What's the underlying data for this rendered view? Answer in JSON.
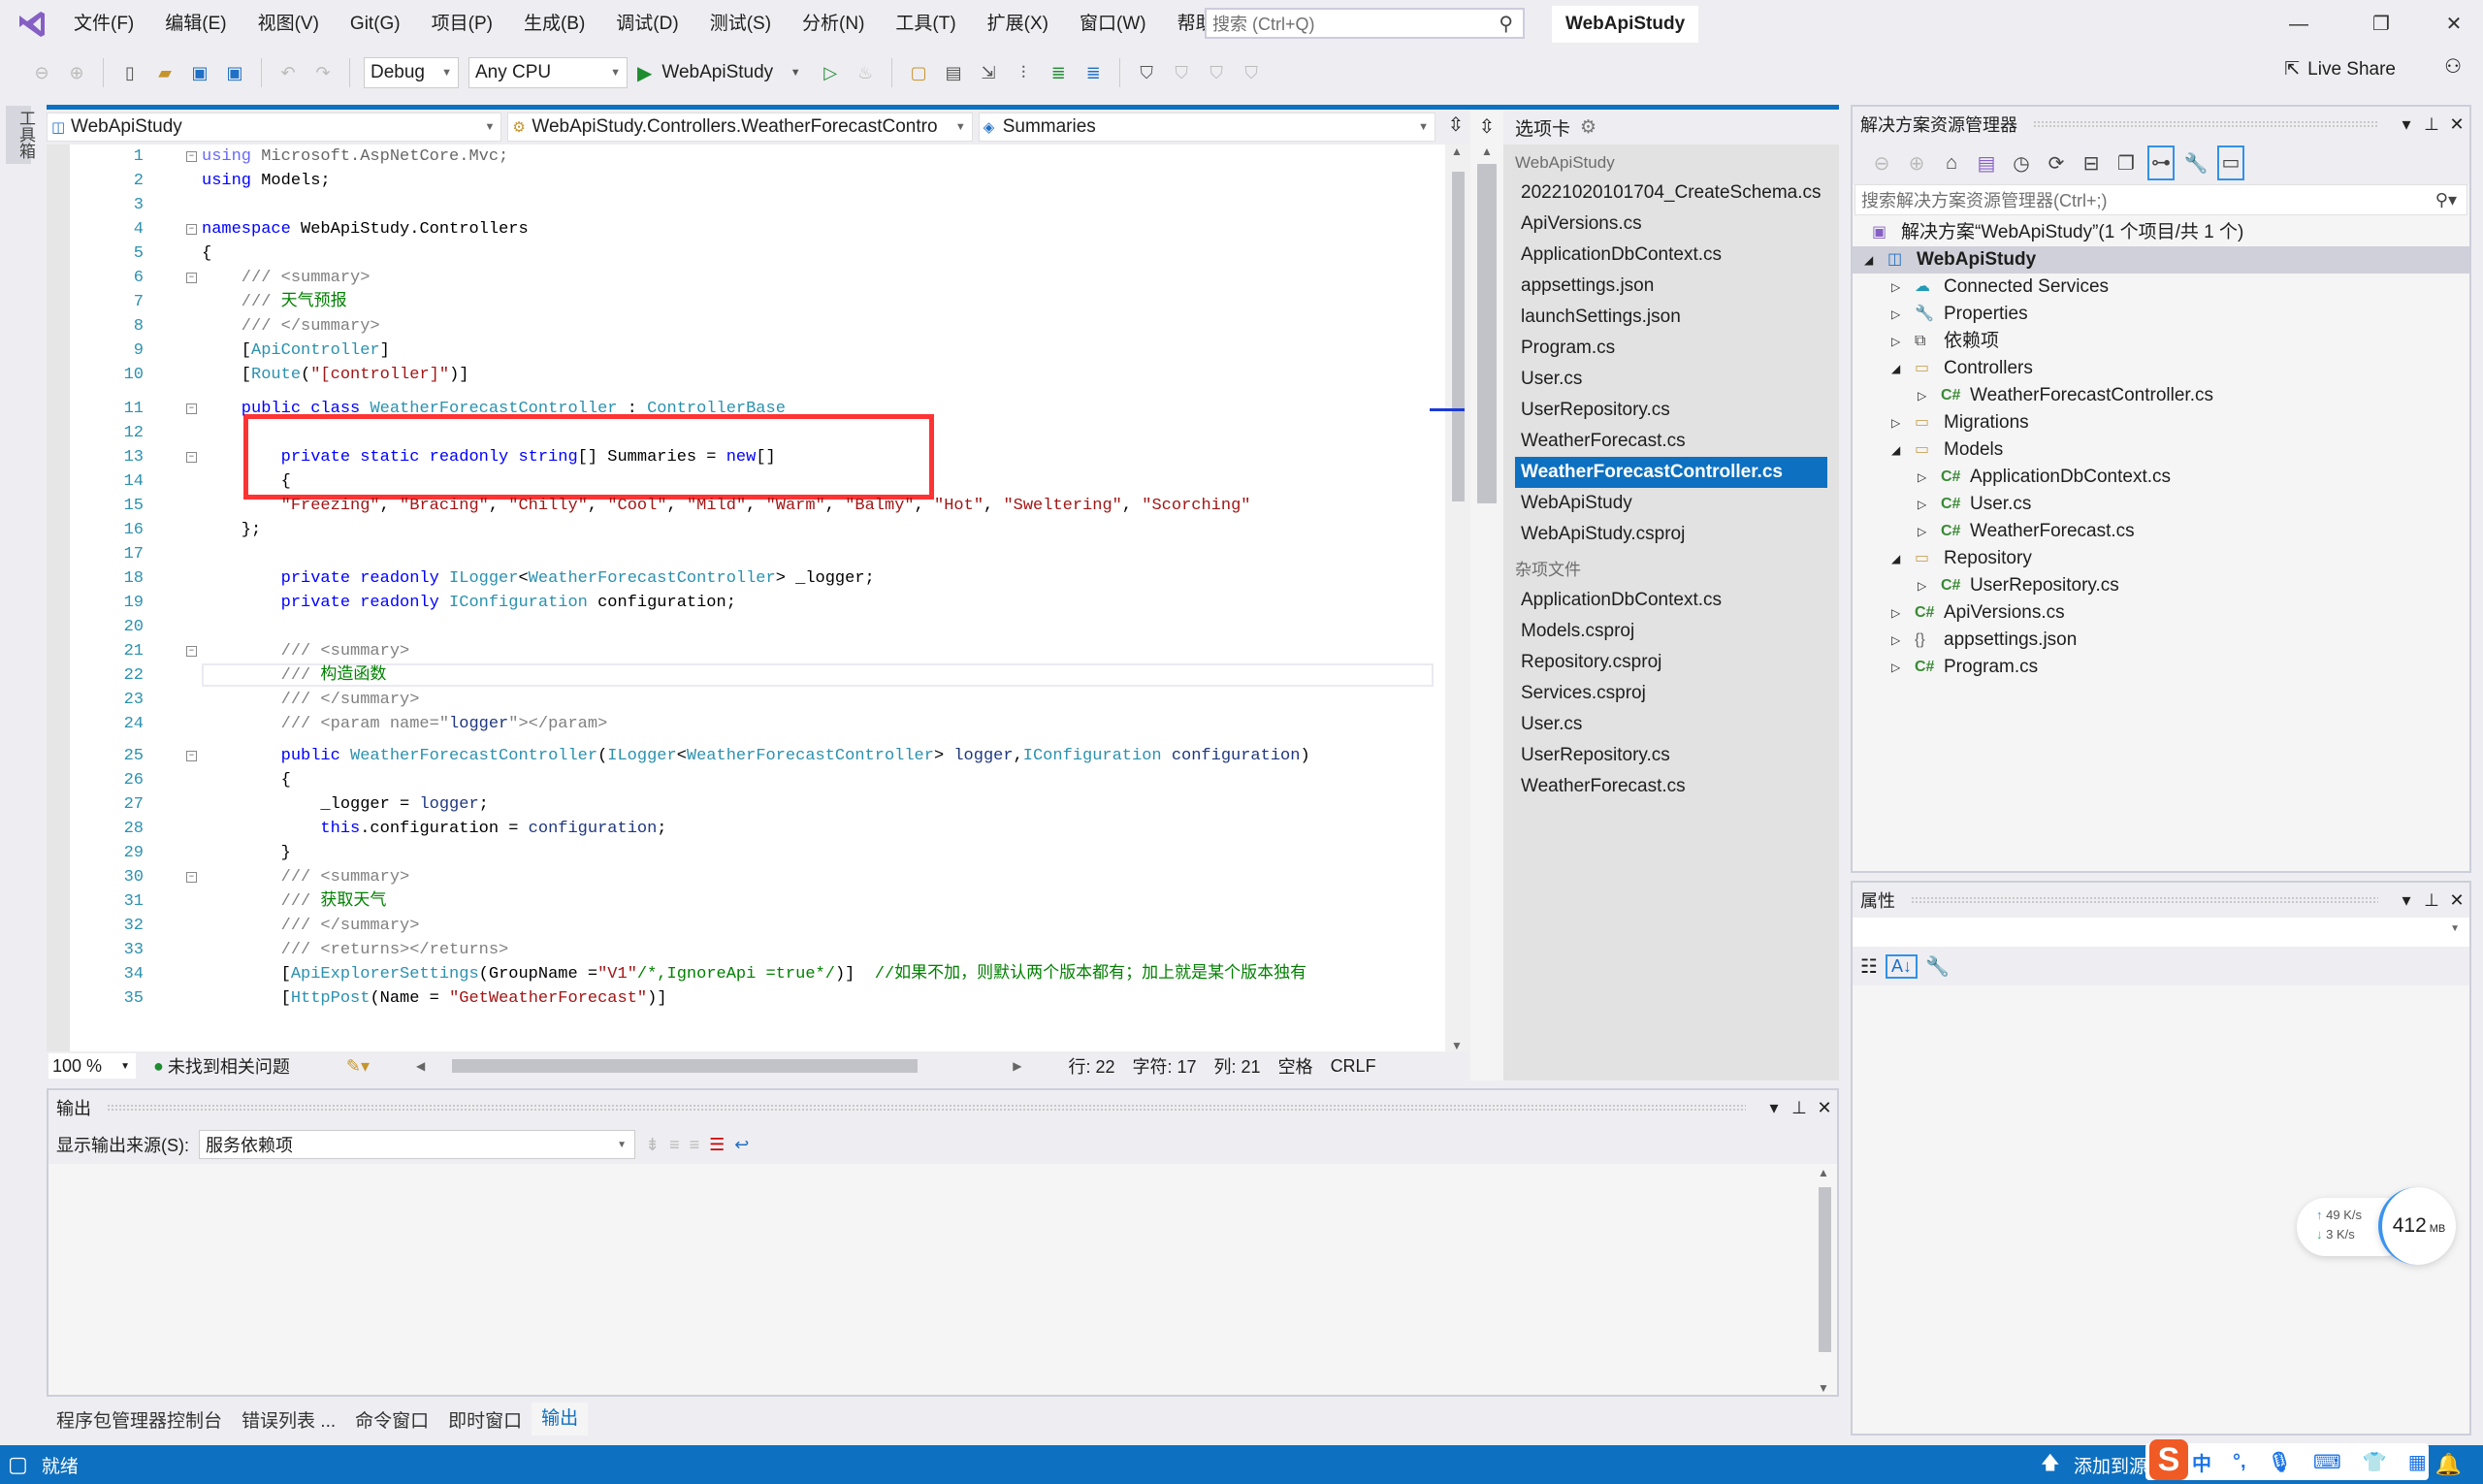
{
  "app": {
    "title": "WebApiStudy",
    "menu": [
      "文件(F)",
      "编辑(E)",
      "视图(V)",
      "Git(G)",
      "项目(P)",
      "生成(B)",
      "调试(D)",
      "测试(S)",
      "分析(N)",
      "工具(T)",
      "扩展(X)",
      "窗口(W)",
      "帮助(H)"
    ],
    "search_placeholder": "搜索 (Ctrl+Q)",
    "accent": "#0e70c0"
  },
  "toolbar": {
    "config": "Debug",
    "platform": "Any CPU",
    "run_target": "WebApiStudy",
    "live_share": "Live Share"
  },
  "left_strip": {
    "toolbox_label": "工具箱"
  },
  "editor": {
    "nav_project": "WebApiStudy",
    "nav_class": "WebApiStudy.Controllers.WeatherForecastContro",
    "nav_member": "Summaries",
    "lines": [
      {
        "n": "1",
        "seg": [
          [
            "kw",
            "using"
          ],
          [
            "pl",
            " Microsoft.AspNetCore.Mvc;"
          ]
        ],
        "dimmed": true,
        "fold": true
      },
      {
        "n": "2",
        "seg": [
          [
            "kw",
            "using"
          ],
          [
            "pl",
            " Models;"
          ]
        ]
      },
      {
        "n": "3",
        "seg": []
      },
      {
        "n": "4",
        "seg": [
          [
            "kw",
            "namespace"
          ],
          [
            "pl",
            " WebApiStudy.Controllers"
          ]
        ],
        "fold": true
      },
      {
        "n": "5",
        "seg": [
          [
            "pl",
            "{"
          ]
        ]
      },
      {
        "n": "6",
        "seg": [
          [
            "dc",
            "    /// <summary>"
          ]
        ],
        "fold": true
      },
      {
        "n": "7",
        "seg": [
          [
            "dc",
            "    /// "
          ],
          [
            "cm",
            "天气预报"
          ]
        ]
      },
      {
        "n": "8",
        "seg": [
          [
            "dc",
            "    /// </summary>"
          ]
        ]
      },
      {
        "n": "9",
        "seg": [
          [
            "pl",
            "    ["
          ],
          [
            "ty",
            "ApiController"
          ],
          [
            "pl",
            "]"
          ]
        ]
      },
      {
        "n": "10",
        "seg": [
          [
            "pl",
            "    ["
          ],
          [
            "ty",
            "Route"
          ],
          [
            "pl",
            "("
          ],
          [
            "st",
            "\"[controller]\""
          ],
          [
            "pl",
            ")]"
          ]
        ]
      },
      {
        "n": "11",
        "seg": [
          [
            "kw",
            "    public class "
          ],
          [
            "ty",
            "WeatherForecastController"
          ],
          [
            "pl",
            " : "
          ],
          [
            "ty",
            "ControllerBase"
          ]
        ],
        "fold": true
      },
      {
        "n": "12",
        "seg": []
      },
      {
        "n": "13",
        "seg": [
          [
            "kw",
            "        private static readonly string"
          ],
          [
            "pl",
            "[] Summaries = "
          ],
          [
            "kw",
            "new"
          ],
          [
            "pl",
            "[]"
          ]
        ],
        "fold": true
      },
      {
        "n": "14",
        "seg": [
          [
            "pl",
            "        {"
          ]
        ]
      },
      {
        "n": "15",
        "seg": [
          [
            "st",
            "        \"Freezing\""
          ],
          [
            "pl",
            ", "
          ],
          [
            "st",
            "\"Bracing\""
          ],
          [
            "pl",
            ", "
          ],
          [
            "st",
            "\"Chilly\""
          ],
          [
            "pl",
            ", "
          ],
          [
            "st",
            "\"Cool\""
          ],
          [
            "pl",
            ", "
          ],
          [
            "st",
            "\"Mild\""
          ],
          [
            "pl",
            ", "
          ],
          [
            "st",
            "\"Warm\""
          ],
          [
            "pl",
            ", "
          ],
          [
            "st",
            "\"Balmy\""
          ],
          [
            "pl",
            ", "
          ],
          [
            "st",
            "\"Hot\""
          ],
          [
            "pl",
            ", "
          ],
          [
            "st",
            "\"Sweltering\""
          ],
          [
            "pl",
            ", "
          ],
          [
            "st",
            "\"Scorching\""
          ]
        ]
      },
      {
        "n": "16",
        "seg": [
          [
            "pl",
            "    };"
          ]
        ]
      },
      {
        "n": "17",
        "seg": []
      },
      {
        "n": "18",
        "seg": [
          [
            "kw",
            "        private readonly "
          ],
          [
            "ty",
            "ILogger"
          ],
          [
            "pl",
            "<"
          ],
          [
            "ty",
            "WeatherForecastController"
          ],
          [
            "pl",
            "> _logger;"
          ]
        ]
      },
      {
        "n": "19",
        "seg": [
          [
            "kw",
            "        private readonly "
          ],
          [
            "ty",
            "IConfiguration"
          ],
          [
            "pl",
            " configuration;"
          ]
        ]
      },
      {
        "n": "20",
        "seg": []
      },
      {
        "n": "21",
        "seg": [
          [
            "dc",
            "        /// <summary>"
          ]
        ],
        "fold": true
      },
      {
        "n": "22",
        "seg": [
          [
            "dc",
            "        /// "
          ],
          [
            "cm",
            "构造函数"
          ]
        ],
        "current": true
      },
      {
        "n": "23",
        "seg": [
          [
            "dc",
            "        /// </summary>"
          ]
        ]
      },
      {
        "n": "24",
        "seg": [
          [
            "dc",
            "        /// <param name=\""
          ],
          [
            "id",
            "logger"
          ],
          [
            "dc",
            "\"></param>"
          ]
        ]
      },
      {
        "n": "25",
        "seg": [
          [
            "kw",
            "        public "
          ],
          [
            "ty",
            "WeatherForecastController"
          ],
          [
            "pl",
            "("
          ],
          [
            "ty",
            "ILogger"
          ],
          [
            "pl",
            "<"
          ],
          [
            "ty",
            "WeatherForecastController"
          ],
          [
            "pl",
            "> "
          ],
          [
            "id",
            "logger"
          ],
          [
            "pl",
            ","
          ],
          [
            "ty",
            "IConfiguration"
          ],
          [
            "pl",
            " "
          ],
          [
            "id",
            "configuration"
          ],
          [
            "pl",
            ")"
          ]
        ],
        "fold": true
      },
      {
        "n": "26",
        "seg": [
          [
            "pl",
            "        {"
          ]
        ]
      },
      {
        "n": "27",
        "seg": [
          [
            "pl",
            "            _logger = "
          ],
          [
            "id",
            "logger"
          ],
          [
            "pl",
            ";"
          ]
        ]
      },
      {
        "n": "28",
        "seg": [
          [
            "kw",
            "            this"
          ],
          [
            "pl",
            ".configuration = "
          ],
          [
            "id",
            "configuration"
          ],
          [
            "pl",
            ";"
          ]
        ]
      },
      {
        "n": "29",
        "seg": [
          [
            "pl",
            "        }"
          ]
        ]
      },
      {
        "n": "30",
        "seg": [
          [
            "dc",
            "        /// <summary>"
          ]
        ],
        "fold": true
      },
      {
        "n": "31",
        "seg": [
          [
            "dc",
            "        /// "
          ],
          [
            "cm",
            "获取天气"
          ]
        ]
      },
      {
        "n": "32",
        "seg": [
          [
            "dc",
            "        /// </summary>"
          ]
        ]
      },
      {
        "n": "33",
        "seg": [
          [
            "dc",
            "        /// <returns></returns>"
          ]
        ]
      },
      {
        "n": "34",
        "seg": [
          [
            "pl",
            "        ["
          ],
          [
            "ty",
            "ApiExplorerSettings"
          ],
          [
            "pl",
            "(GroupName ="
          ],
          [
            "st",
            "\"V1\""
          ],
          [
            "cm",
            "/*,IgnoreApi =true*/"
          ],
          [
            "pl",
            ")]  "
          ],
          [
            "cm",
            "//如果不加，则默认两个版本都有；加上就是某个版本独有"
          ]
        ]
      },
      {
        "n": "35",
        "seg": [
          [
            "pl",
            "        ["
          ],
          [
            "ty",
            "HttpPost"
          ],
          [
            "pl",
            "(Name = "
          ],
          [
            "st",
            "\"GetWeatherForecast\""
          ],
          [
            "pl",
            ")]"
          ]
        ]
      }
    ],
    "status": {
      "zoom": "100 %",
      "issues": "未找到相关问题",
      "row": "行: 22",
      "char": "字符: 17",
      "col": "列: 21",
      "spaces": "空格",
      "eol": "CRLF"
    }
  },
  "tabs_panel": {
    "title": "选项卡",
    "groups": [
      {
        "name": "WebApiStudy",
        "items": [
          "20221020101704_CreateSchema.cs",
          "ApiVersions.cs",
          "ApplicationDbContext.cs",
          "appsettings.json",
          "launchSettings.json",
          "Program.cs",
          "User.cs",
          "UserRepository.cs",
          "WeatherForecast.cs",
          "WeatherForecastController.cs",
          "WebApiStudy",
          "WebApiStudy.csproj"
        ],
        "selected": "WeatherForecastController.cs"
      },
      {
        "name": "杂项文件",
        "items": [
          "ApplicationDbContext.cs",
          "Models.csproj",
          "Repository.csproj",
          "Services.csproj",
          "User.cs",
          "UserRepository.cs",
          "WeatherForecast.cs"
        ]
      }
    ]
  },
  "solution_explorer": {
    "title": "解决方案资源管理器",
    "search_placeholder": "搜索解决方案资源管理器(Ctrl+;)",
    "solution": "解决方案“WebApiStudy”(1 个项目/共 1 个)",
    "tree": [
      {
        "label": "WebApiStudy",
        "level": 0,
        "icon": "project-icon",
        "expanded": true,
        "selected": true
      },
      {
        "label": "Connected Services",
        "level": 1,
        "icon": "connected-services-icon",
        "expanded": false
      },
      {
        "label": "Properties",
        "level": 1,
        "icon": "properties-icon",
        "expanded": false
      },
      {
        "label": "依赖项",
        "level": 1,
        "icon": "dependencies-icon",
        "expanded": false
      },
      {
        "label": "Controllers",
        "level": 1,
        "icon": "folder-open-icon",
        "expanded": true
      },
      {
        "label": "WeatherForecastController.cs",
        "level": 2,
        "icon": "csharp-file-icon",
        "expanded": false
      },
      {
        "label": "Migrations",
        "level": 1,
        "icon": "folder-icon",
        "expanded": false
      },
      {
        "label": "Models",
        "level": 1,
        "icon": "folder-open-icon",
        "expanded": true
      },
      {
        "label": "ApplicationDbContext.cs",
        "level": 2,
        "icon": "csharp-file-icon",
        "expanded": false
      },
      {
        "label": "User.cs",
        "level": 2,
        "icon": "csharp-file-icon",
        "expanded": false
      },
      {
        "label": "WeatherForecast.cs",
        "level": 2,
        "icon": "csharp-file-icon",
        "expanded": false
      },
      {
        "label": "Repository",
        "level": 1,
        "icon": "folder-open-icon",
        "expanded": true
      },
      {
        "label": "UserRepository.cs",
        "level": 2,
        "icon": "csharp-file-icon",
        "expanded": false
      },
      {
        "label": "ApiVersions.cs",
        "level": 1,
        "icon": "csharp-file-icon",
        "expanded": false
      },
      {
        "label": "appsettings.json",
        "level": 1,
        "icon": "json-file-icon",
        "expanded": false
      },
      {
        "label": "Program.cs",
        "level": 1,
        "icon": "csharp-file-icon",
        "expanded": false
      }
    ]
  },
  "properties": {
    "title": "属性"
  },
  "output": {
    "title": "输出",
    "source_label": "显示输出来源(S):",
    "source_value": "服务依赖项"
  },
  "bottom_tabs": [
    "程序包管理器控制台",
    "错误列表 ...",
    "命令窗口",
    "即时窗口",
    "输出"
  ],
  "bottom_tab_active": "输出",
  "statusbar": {
    "ready": "就绪",
    "add_source": "添加到源代码管理"
  },
  "ime": {
    "mode": "中",
    "punct": "°,"
  },
  "net_widget": {
    "up": "49  K/s",
    "down": "3   K/s",
    "memory": "412",
    "memory_unit": "MB"
  }
}
